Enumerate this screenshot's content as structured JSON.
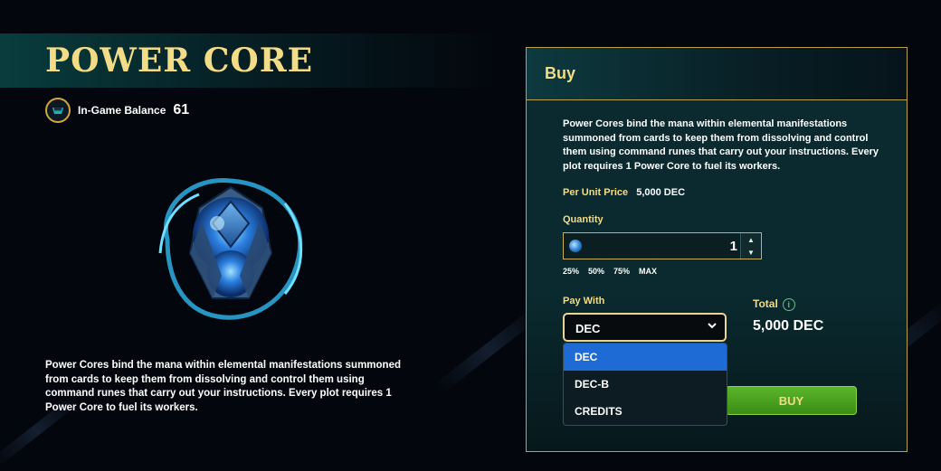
{
  "page": {
    "title": "POWER CORE",
    "balance": {
      "label": "In-Game Balance",
      "value": "61"
    },
    "description": "Power Cores bind the mana within elemental manifestations summoned from cards to keep them from dissolving and control them using command runes that carry out your instructions. Every plot requires 1 Power Core to fuel its workers."
  },
  "buy_panel": {
    "header": "Buy",
    "description": "Power Cores bind the mana within elemental manifestations summoned from cards to keep them from dissolving and control them using command runes that carry out your instructions. Every plot requires 1 Power Core to fuel its workers.",
    "per_unit_label": "Per Unit Price",
    "per_unit_value": "5,000 DEC",
    "quantity_label": "Quantity",
    "quantity_value": "1",
    "percent_options": [
      "25%",
      "50%",
      "75%",
      "MAX"
    ],
    "pay_with_label": "Pay With",
    "pay_with_selected": "DEC",
    "pay_with_options": [
      "DEC",
      "DEC-B",
      "CREDITS"
    ],
    "total_label": "Total",
    "total_value": "5,000 DEC",
    "buy_label": "BUY"
  },
  "icons": {
    "balance": "power-core-badge-icon",
    "info": "info-icon",
    "chevron": "chevron-down-icon"
  },
  "colors": {
    "gold": "#f3dc86",
    "panel_border": "#b9a24e",
    "buy_green": "#4aa321",
    "select_highlight": "#1f6bd6"
  }
}
